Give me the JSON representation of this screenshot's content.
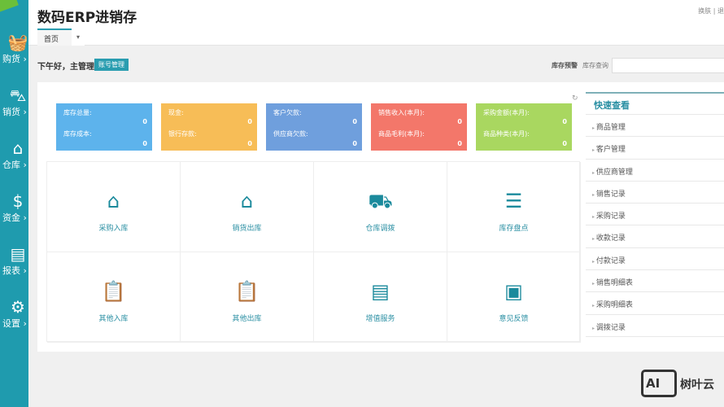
{
  "app": {
    "title": "数码ERP进销存",
    "top_links": "换肤 | 退"
  },
  "sidebar": {
    "items": [
      {
        "label": "购货 ›",
        "icon": "basket-icon"
      },
      {
        "label": "销货 ›",
        "icon": "cart-icon"
      },
      {
        "label": "仓库 ›",
        "icon": "warehouse-icon"
      },
      {
        "label": "资金 ›",
        "icon": "dollar-icon"
      },
      {
        "label": "报表 ›",
        "icon": "report-icon"
      },
      {
        "label": "设置 ›",
        "icon": "gear-icon"
      }
    ]
  },
  "tabs": [
    {
      "label": "首页",
      "active": true
    }
  ],
  "greeting": "下午好，主管理",
  "account_button": "账号管理",
  "stock_warning": "库存预警",
  "stock_query": "库存查询",
  "cards": [
    {
      "color": "#5db3ec",
      "l1": "库存总量:",
      "v1": "0",
      "l2": "库存成本:",
      "v2": "0"
    },
    {
      "color": "#f7bd57",
      "l1": "现金:",
      "v1": "0",
      "l2": "银行存款:",
      "v2": "0"
    },
    {
      "color": "#6f9fdd",
      "l1": "客户欠款:",
      "v1": "0",
      "l2": "供应商欠款:",
      "v2": "0"
    },
    {
      "color": "#f3776a",
      "l1": "销售收入(本月):",
      "v1": "0",
      "l2": "商品毛利(本月):",
      "v2": "0"
    },
    {
      "color": "#a9d760",
      "l1": "采购金额(本月):",
      "v1": "0",
      "l2": "商品种类(本月):",
      "v2": "0"
    }
  ],
  "actions": [
    {
      "label": "采购入库",
      "icon": "purchase-in-icon",
      "glyph": "⌂"
    },
    {
      "label": "销货出库",
      "icon": "sales-out-icon",
      "glyph": "⌂"
    },
    {
      "label": "仓库调拨",
      "icon": "truck-icon",
      "glyph": "⛟"
    },
    {
      "label": "库存盘点",
      "icon": "inventory-check-icon",
      "glyph": "☰"
    },
    {
      "label": "其他入库",
      "icon": "clipboard-in-icon",
      "glyph": "📋"
    },
    {
      "label": "其他出库",
      "icon": "clipboard-out-icon",
      "glyph": "📋"
    },
    {
      "label": "增值服务",
      "icon": "service-box-icon",
      "glyph": "▤"
    },
    {
      "label": "意见反馈",
      "icon": "feedback-monitor-icon",
      "glyph": "▣"
    }
  ],
  "quick": {
    "title": "快速查看",
    "items": [
      "商品管理",
      "客户管理",
      "供应商管理",
      "销售记录",
      "采购记录",
      "收款记录",
      "付款记录",
      "销售明细表",
      "采购明细表",
      "调拨记录"
    ]
  },
  "watermark": {
    "logo": "AI",
    "text": "树叶云"
  }
}
